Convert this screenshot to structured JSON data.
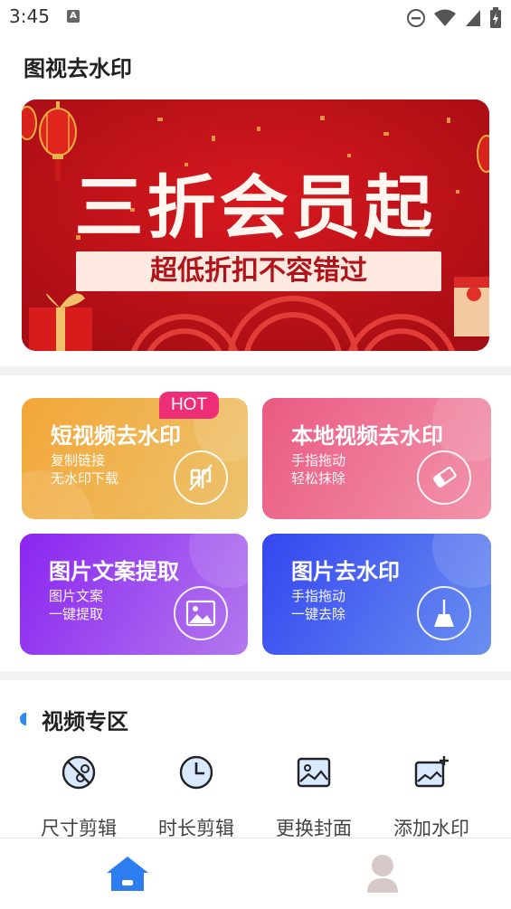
{
  "status_bar": {
    "time": "3:45",
    "notification_icon_letter": "A"
  },
  "app": {
    "title": "图视去水印"
  },
  "banner": {
    "title": "三折会员起",
    "subtitle": "超低折扣不容错过"
  },
  "feature_cards": [
    {
      "title": "短视频去水印",
      "line1": "复制链接",
      "line2": "无水印下载",
      "badge": "HOT",
      "icon": "no-watermark-icon",
      "colors": [
        "#f2a93b",
        "#eec269"
      ]
    },
    {
      "title": "本地视频去水印",
      "line1": "手指拖动",
      "line2": "轻松抹除",
      "icon": "eraser-icon",
      "colors": [
        "#ec5f86",
        "#f08fa8"
      ]
    },
    {
      "title": "图片文案提取",
      "line1": "图片文案",
      "line2": "一键提取",
      "icon": "image-icon",
      "colors": [
        "#8f2df0",
        "#b06ef0"
      ]
    },
    {
      "title": "图片去水印",
      "line1": "手指拖动",
      "line2": "一键去除",
      "icon": "broom-icon",
      "colors": [
        "#3b4df0",
        "#5f86f0"
      ]
    }
  ],
  "video_section": {
    "title": "视频专区",
    "tools": [
      {
        "label": "尺寸剪辑",
        "icon": "scissors-icon"
      },
      {
        "label": "时长剪辑",
        "icon": "clock-icon"
      },
      {
        "label": "更换封面",
        "icon": "cover-image-icon"
      },
      {
        "label": "添加水印",
        "icon": "add-image-icon"
      }
    ]
  },
  "bottom_nav": [
    {
      "icon": "home-icon",
      "active": true,
      "color": "#2d7df0"
    },
    {
      "icon": "profile-icon",
      "active": false,
      "color": "#d8c9c9"
    }
  ]
}
